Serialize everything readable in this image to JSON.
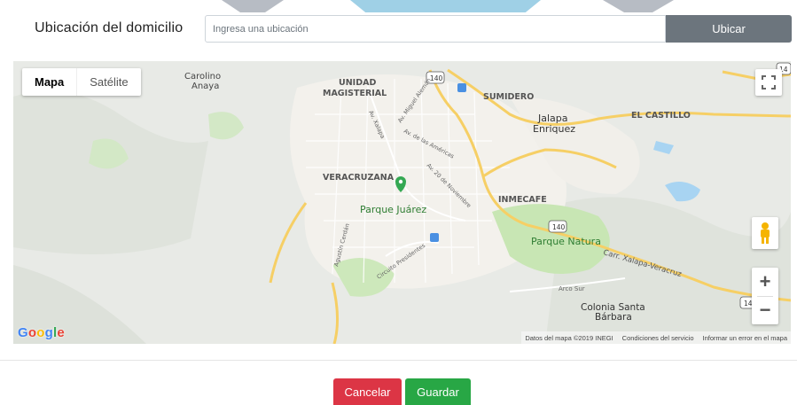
{
  "form": {
    "location_label": "Ubicación del domicilio",
    "location_placeholder": "Ingresa una ubicación",
    "locate_button": "Ubicar"
  },
  "map": {
    "map_types": [
      "Mapa",
      "Satélite"
    ],
    "selected_map_type": "Mapa",
    "labels": {
      "carolino": "Carolino",
      "anaya": "Anaya",
      "unidad": "UNIDAD",
      "magisterial": "MAGISTERIAL",
      "sumidero": "SUMIDERO",
      "jalapa": "Jalapa",
      "enriquez": "Enriquez",
      "el_castillo": "EL CASTILLO",
      "veracruzana": "VERACRUZANA",
      "parque_juarez": "Parque Juárez",
      "inmecafe": "INMECAFE",
      "parque_natura": "Parque Natura",
      "colonia_santa": "Colonia Santa",
      "barbara": "Bárbara",
      "arco_sur": "Arco Sur",
      "carr_xalapa": "Carr. Xalapa-Veracruz",
      "av_americas": "Av. de las Américas",
      "av_20_nov": "Av. 20 de Noviembre",
      "av_xalapa": "Av. Xalapa",
      "av_miguel_aleman": "Av. Miguel Alemán",
      "circuito_presidentes": "Circuito Presidentes",
      "agustin_cerdan": "Agustín Cerdán",
      "route_140": "140",
      "route_14": "14"
    },
    "google_logo": "Google",
    "attribution": {
      "data": "Datos del mapa ©2019 INEGI",
      "terms": "Condiciones del servicio",
      "report": "Informar un error en el mapa"
    },
    "zoom_in": "+",
    "zoom_out": "−"
  },
  "actions": {
    "cancel": "Cancelar",
    "save": "Guardar"
  },
  "colors": {
    "secondary": "#6c757d",
    "danger": "#dc3545",
    "success": "#28a745",
    "park_green": "#c8e6b4",
    "road_yellow": "#f6cf65"
  }
}
